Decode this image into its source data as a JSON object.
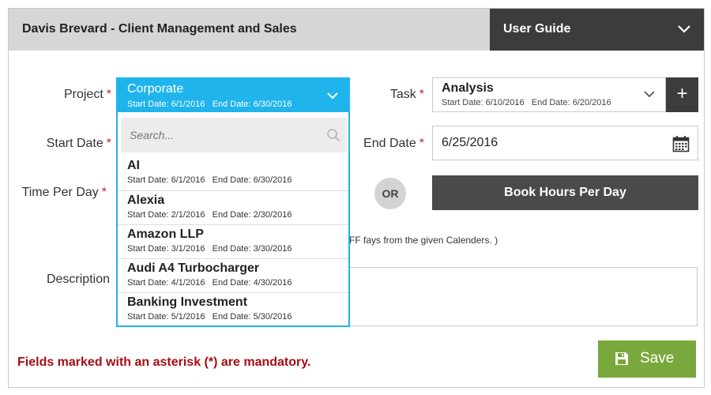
{
  "header": {
    "title": "Davis Brevard - Client Management and Sales",
    "user_guide": "User Guide"
  },
  "labels": {
    "project": "Project",
    "task": "Task",
    "start_date": "Start Date",
    "end_date": "End Date",
    "time_per_day": "Time Per Day",
    "description": "Description",
    "asterisk": "*"
  },
  "project_dropdown": {
    "selected_title": "Corporate",
    "selected_dates": "Start Date: 6/1/2016   End Date: 6/30/2016",
    "search_placeholder": "Search...",
    "items": [
      {
        "name": "AI",
        "dates": "Start Date: 6/1/2016   End Date: 6/30/2016"
      },
      {
        "name": "Alexia",
        "dates": "Start Date: 2/1/2016   End Date: 2/30/2016"
      },
      {
        "name": "Amazon LLP",
        "dates": "Start Date: 3/1/2016   End Date: 3/30/2016"
      },
      {
        "name": "Audi A4 Turbocharger",
        "dates": "Start Date: 4/1/2016   End Date: 4/30/2016"
      },
      {
        "name": "Banking Investment",
        "dates": "Start Date: 5/1/2016   End Date: 5/30/2016"
      }
    ]
  },
  "task": {
    "name": "Analysis",
    "dates": "Start Date: 6/10/2016   End Date: 6/20/2016",
    "add_label": "+"
  },
  "end_date": {
    "value": "6/25/2016"
  },
  "time": {
    "or_label": "OR",
    "book_label": "Book Hours Per Day",
    "note": "FF fays from the given Calenders. )"
  },
  "footer": {
    "mandatory_note": "Fields marked with an asterisk (*) are mandatory.",
    "save_label": "Save"
  },
  "colors": {
    "accent_blue": "#1fb4ec",
    "dark_button": "#3c3c3c",
    "save_green": "#79a83c",
    "required_red": "#c0272d",
    "mandatory_text": "#a40e14"
  },
  "icons": {
    "user_guide": "chevron-down-icon",
    "project_select": "chevron-down-icon",
    "search": "search-icon",
    "task_select": "chevron-down-icon",
    "add_task": "plus-icon",
    "end_date": "calendar-icon",
    "save": "floppy-disk-icon"
  }
}
